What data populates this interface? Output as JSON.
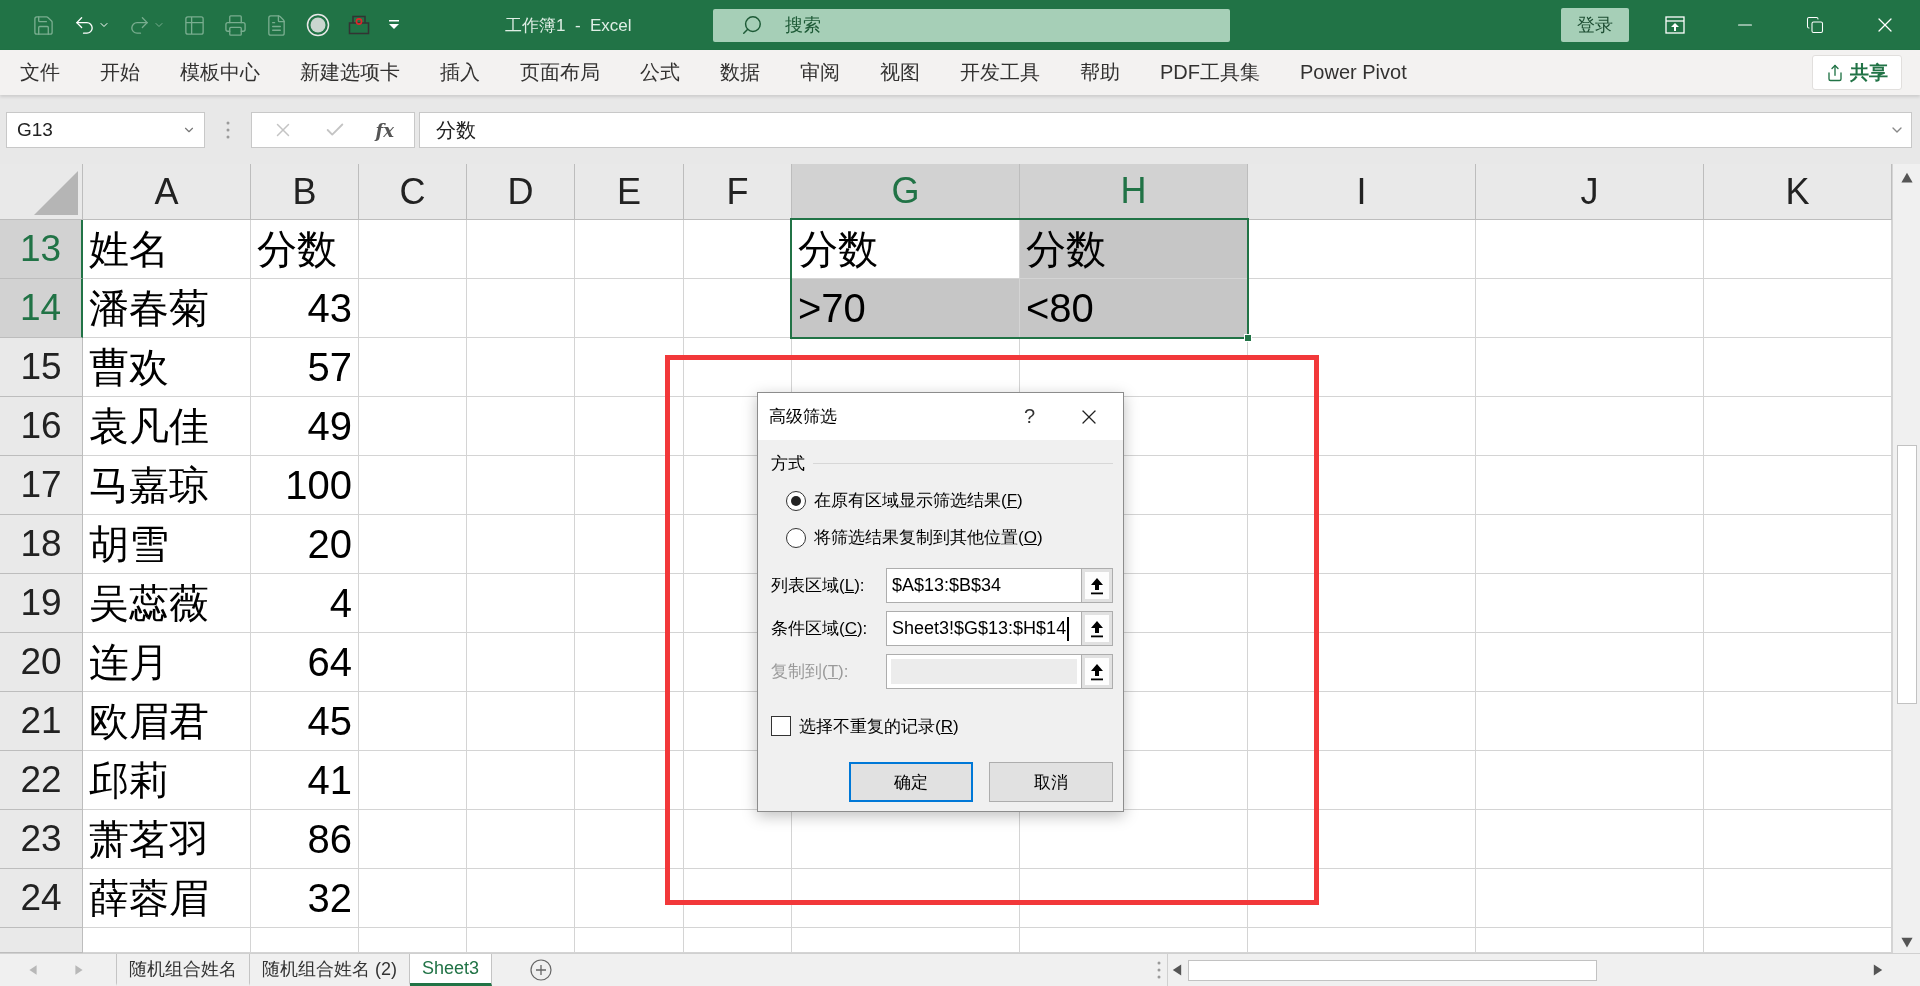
{
  "title_bar": {
    "quick_access": [
      {
        "kind": "save",
        "disabled": true
      },
      {
        "kind": "undo",
        "disabled": false
      },
      {
        "kind": "redo",
        "disabled": true
      },
      {
        "kind": "form",
        "disabled": true
      },
      {
        "kind": "print_preview",
        "disabled": true
      },
      {
        "kind": "document",
        "disabled": true
      },
      {
        "kind": "circle",
        "disabled": false
      },
      {
        "kind": "stamp",
        "disabled": false
      },
      {
        "kind": "customize",
        "disabled": false
      }
    ],
    "title": "工作簿1  -  Excel",
    "search_placeholder": "搜索",
    "sign_in": "登录"
  },
  "ribbon_tabs": [
    "文件",
    "开始",
    "模板中心",
    "新建选项卡",
    "插入",
    "页面布局",
    "公式",
    "数据",
    "审阅",
    "视图",
    "开发工具",
    "帮助",
    "PDF工具集",
    "Power Pivot"
  ],
  "share_button": "共享",
  "formula_bar": {
    "name_box": "G13",
    "buttons": [
      {
        "kind": "cancel",
        "disabled": true
      },
      {
        "kind": "enter",
        "disabled": true
      }
    ],
    "function_button": "fx",
    "formula": "分数"
  },
  "sheet": {
    "columns": [
      {
        "label": "A",
        "selected": false
      },
      {
        "label": "B",
        "selected": false
      },
      {
        "label": "C",
        "selected": false
      },
      {
        "label": "D",
        "selected": false
      },
      {
        "label": "E",
        "selected": false
      },
      {
        "label": "F",
        "selected": false
      },
      {
        "label": "G",
        "selected": true
      },
      {
        "label": "H",
        "selected": true
      },
      {
        "label": "I",
        "selected": false
      },
      {
        "label": "J",
        "selected": false
      },
      {
        "label": "K",
        "selected": false
      }
    ],
    "rows": [
      {
        "number": "13",
        "selected": true,
        "cells": [
          {
            "text": "姓名",
            "kind": "text"
          },
          {
            "text": "分数",
            "kind": "text"
          }
        ],
        "criteria_cells": [
          {
            "text": "分数",
            "active": true
          },
          {
            "text": "分数",
            "active": false
          }
        ]
      },
      {
        "number": "14",
        "selected": true,
        "cells": [
          {
            "text": "潘春菊",
            "kind": "text"
          },
          {
            "text": "43",
            "kind": "number"
          }
        ],
        "criteria_cells": [
          {
            "text": ">70",
            "active": false
          },
          {
            "text": "<80",
            "active": false
          }
        ]
      },
      {
        "number": "15",
        "selected": false,
        "cells": [
          {
            "text": "曹欢",
            "kind": "text"
          },
          {
            "text": "57",
            "kind": "number"
          }
        ]
      },
      {
        "number": "16",
        "selected": false,
        "cells": [
          {
            "text": "袁凡佳",
            "kind": "text"
          },
          {
            "text": "49",
            "kind": "number"
          }
        ]
      },
      {
        "number": "17",
        "selected": false,
        "cells": [
          {
            "text": "马嘉琼",
            "kind": "text"
          },
          {
            "text": "100",
            "kind": "number"
          }
        ]
      },
      {
        "number": "18",
        "selected": false,
        "cells": [
          {
            "text": "胡雪",
            "kind": "text"
          },
          {
            "text": "20",
            "kind": "number"
          }
        ]
      },
      {
        "number": "19",
        "selected": false,
        "cells": [
          {
            "text": "吴蕊薇",
            "kind": "text"
          },
          {
            "text": "4",
            "kind": "number"
          }
        ]
      },
      {
        "number": "20",
        "selected": false,
        "cells": [
          {
            "text": "连月",
            "kind": "text"
          },
          {
            "text": "64",
            "kind": "number"
          }
        ]
      },
      {
        "number": "21",
        "selected": false,
        "cells": [
          {
            "text": "欧眉君",
            "kind": "text"
          },
          {
            "text": "45",
            "kind": "number"
          }
        ]
      },
      {
        "number": "22",
        "selected": false,
        "cells": [
          {
            "text": "邱莉",
            "kind": "text"
          },
          {
            "text": "41",
            "kind": "number"
          }
        ]
      },
      {
        "number": "23",
        "selected": false,
        "cells": [
          {
            "text": "萧茗羽",
            "kind": "text"
          },
          {
            "text": "86",
            "kind": "number"
          }
        ]
      },
      {
        "number": "24",
        "selected": false,
        "cells": [
          {
            "text": "薛蓉眉",
            "kind": "text"
          },
          {
            "text": "32",
            "kind": "number"
          }
        ]
      }
    ]
  },
  "dialog": {
    "title": "高级筛选",
    "help": "?",
    "group_label": "方式",
    "options": [
      {
        "text": "在原有区域显示筛选结果(",
        "access_key": "F",
        "text_end": ")",
        "selected": true
      },
      {
        "text": "将筛选结果复制到其他位置(",
        "access_key": "O",
        "text_end": ")",
        "selected": false
      }
    ],
    "fields": [
      {
        "text": "列表区域(",
        "access_key": "L",
        "text_end": "):",
        "value": "$A$13:$B$34",
        "disabled": false,
        "focused": false
      },
      {
        "text": "条件区域(",
        "access_key": "C",
        "text_end": "):",
        "value": "Sheet3!$G$13:$H$14",
        "disabled": false,
        "focused": true
      },
      {
        "text": "复制到(",
        "access_key": "T",
        "text_end": "):",
        "disabled": true,
        "focused": false
      }
    ],
    "unique_records": {
      "text": "选择不重复的记录(",
      "access_key": "R",
      "text_end": ")",
      "checked": false
    },
    "buttons": [
      {
        "label": "确定",
        "default": true
      },
      {
        "label": "取消",
        "default": false
      }
    ]
  },
  "sheet_tabs": [
    {
      "label": "随机组合姓名",
      "selected": false
    },
    {
      "label": "随机组合姓名 (2)",
      "selected": false
    },
    {
      "label": "Sheet3",
      "selected": true
    }
  ]
}
